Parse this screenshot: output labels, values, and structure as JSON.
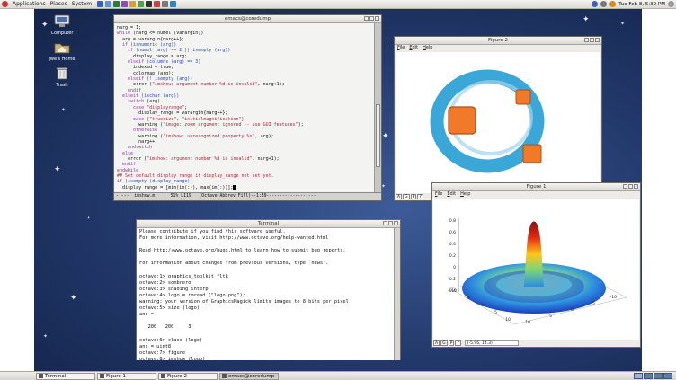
{
  "top_panel": {
    "menus": [
      "Applications",
      "Places",
      "System"
    ],
    "clock": "Tue Feb 8, 5:39 PM"
  },
  "desktop_icons": [
    {
      "label": "Computer"
    },
    {
      "label": "jwe's Home"
    },
    {
      "label": "Trash"
    }
  ],
  "emacs": {
    "title": "emacs@coredump",
    "modeline": "-:---  imshow.m      51% L119   (Octave Abbrev Fill)--1:39-------------------",
    "lines": [
      [
        {
          "t": "narg = 1;",
          "c": "txt"
        }
      ],
      [
        {
          "t": "while",
          "c": "kw"
        },
        {
          "t": " (narg <= numel (varargin))",
          "c": "txt"
        }
      ],
      [
        {
          "t": "  arg = varargin{narg++};",
          "c": "txt"
        }
      ],
      [
        {
          "t": "  if",
          "c": "kw"
        },
        {
          "t": " (isnumeric (arg))",
          "c": "fn"
        }
      ],
      [
        {
          "t": "    if",
          "c": "kw"
        },
        {
          "t": " (numel (arg) == 2 || isempty (arg))",
          "c": "fn"
        }
      ],
      [
        {
          "t": "      display_range = arg;",
          "c": "txt"
        }
      ],
      [
        {
          "t": "    elseif",
          "c": "kw"
        },
        {
          "t": " (columns (arg) == 3)",
          "c": "fn"
        }
      ],
      [
        {
          "t": "      indexed = true;",
          "c": "txt"
        }
      ],
      [
        {
          "t": "      colormap (arg);",
          "c": "txt"
        }
      ],
      [
        {
          "t": "    elseif",
          "c": "kw"
        },
        {
          "t": " (! isempty (arg))",
          "c": "fn"
        }
      ],
      [
        {
          "t": "      error (",
          "c": "txt"
        },
        {
          "t": "\"imshow: argument number %d is invalid\"",
          "c": "str"
        },
        {
          "t": ", narg+1);",
          "c": "txt"
        }
      ],
      [
        {
          "t": "    endif",
          "c": "kw"
        }
      ],
      [
        {
          "t": "  elseif",
          "c": "kw"
        },
        {
          "t": " (ischar (arg))",
          "c": "fn"
        }
      ],
      [
        {
          "t": "    switch",
          "c": "kw"
        },
        {
          "t": " (arg)",
          "c": "txt"
        }
      ],
      [
        {
          "t": "      case",
          "c": "kw"
        },
        {
          "t": " \"displayrange\"",
          "c": "str"
        },
        {
          "t": ";",
          "c": "txt"
        }
      ],
      [
        {
          "t": "        display_range = varargin{narg++};",
          "c": "txt"
        }
      ],
      [
        {
          "t": "      case",
          "c": "kw"
        },
        {
          "t": " {\"truesize\", \"initialmagnification\"}",
          "c": "str"
        }
      ],
      [
        {
          "t": "        warning (",
          "c": "txt"
        },
        {
          "t": "\"image: zoom argument ignored -- use GUI features\"",
          "c": "str"
        },
        {
          "t": ");",
          "c": "txt"
        }
      ],
      [
        {
          "t": "      otherwise",
          "c": "kw"
        }
      ],
      [
        {
          "t": "        warning (",
          "c": "txt"
        },
        {
          "t": "\"imshow: unrecognized property %s\"",
          "c": "str"
        },
        {
          "t": ", arg);",
          "c": "txt"
        }
      ],
      [
        {
          "t": "        narg++;",
          "c": "txt"
        }
      ],
      [
        {
          "t": "    endswitch",
          "c": "kw"
        }
      ],
      [
        {
          "t": "  else",
          "c": "kw"
        }
      ],
      [
        {
          "t": "    error (",
          "c": "txt"
        },
        {
          "t": "\"imshow: argument number %d is invalid\"",
          "c": "str"
        },
        {
          "t": ", narg+1);",
          "c": "txt"
        }
      ],
      [
        {
          "t": "  endif",
          "c": "kw"
        }
      ],
      [
        {
          "t": "endwhile",
          "c": "kw"
        }
      ],
      [
        {
          "t": "",
          "c": "txt"
        }
      ],
      [
        {
          "t": "## Set default display range if display_range not set yet.",
          "c": "cmt"
        }
      ],
      [
        {
          "t": "if",
          "c": "kw"
        },
        {
          "t": " (isempty (display_range))",
          "c": "fn"
        }
      ],
      [
        {
          "t": "  display_range = [min(im(:)), max(im(:))];",
          "c": "txt"
        }
      ]
    ]
  },
  "terminal": {
    "title": "Terminal",
    "lines": [
      "Please contribute if you find this software useful.",
      "For more information, visit http://www.octave.org/help-wanted.html",
      "",
      "Read http://www.octave.org/bugs.html to learn how to submit bug reports.",
      "",
      "For information about changes from previous versions, type `news'.",
      "",
      "octave:1> graphics_toolkit fltk",
      "octave:2> sombrero",
      "octave:3> shading interp",
      "octave:4> logo = imread (\"logo.png\");",
      "warning: your version of GraphicsMagick limits images to 8 bits per pixel",
      "octave:5> size (logo)",
      "ans =",
      "",
      "   200   200     3",
      "",
      "octave:6> class (logo)",
      "ans = uint8",
      "octave:7> figure",
      "octave:8> imshow (logo)",
      "octave:9> edit imshow",
      "octave:10> "
    ]
  },
  "figure2": {
    "title": "Figure 2",
    "menus": [
      "File",
      "Edit",
      "Help"
    ],
    "toolbar": [
      "A",
      "G",
      "P",
      "?"
    ]
  },
  "figure1": {
    "title": "Figure 1",
    "menus": [
      "File",
      "Edit",
      "Help"
    ],
    "toolbar": [
      "A",
      "G",
      "P",
      "?"
    ],
    "coords": "(-5.96, 14.3)",
    "z_ticks": [
      "0.8",
      "0.6",
      "0.4",
      "0.2",
      "0",
      "-0.2",
      "-0.4"
    ],
    "x_ticks": [
      "-10",
      "-5",
      "0",
      "5",
      "10"
    ],
    "y_ticks": [
      "10",
      "5",
      "0",
      "-5",
      "-10"
    ]
  },
  "taskbar": {
    "tasks": [
      "Terminal",
      "Figure 1",
      "Figure 2",
      "emacs@coredump"
    ],
    "active_index": 3
  },
  "colors": {
    "logo_ring": "#3aa7d8",
    "logo_square": "#f07a2a",
    "desktop_bg": "#22386a"
  }
}
